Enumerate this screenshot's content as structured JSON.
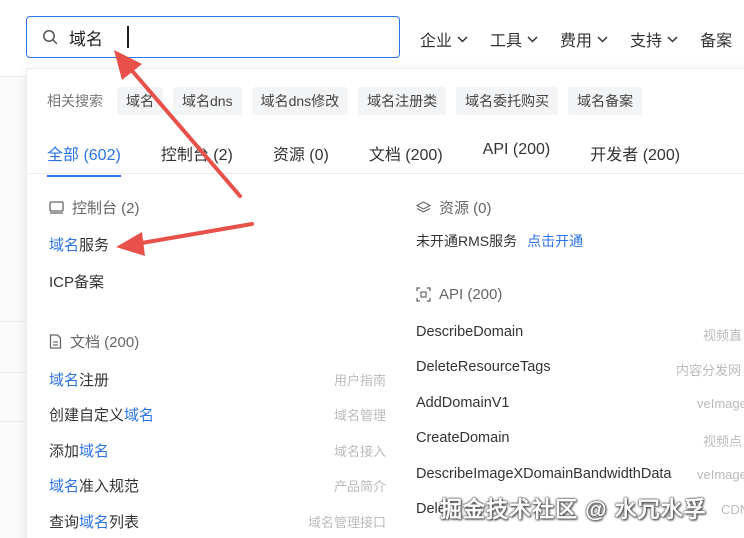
{
  "search": {
    "value": "域名"
  },
  "nav": [
    "企业",
    "工具",
    "费用",
    "支持",
    "备案"
  ],
  "related": {
    "label": "相关搜索",
    "tags": [
      "域名",
      "域名dns",
      "域名dns修改",
      "域名注册类",
      "域名委托购买",
      "域名备案"
    ]
  },
  "tabs": [
    "全部 (602)",
    "控制台 (2)",
    "资源 (0)",
    "文档 (200)",
    "API (200)",
    "开发者 (200)"
  ],
  "console": {
    "title": "控制台 (2)",
    "items": [
      {
        "hl": "域名",
        "rest": "服务"
      },
      {
        "hl": "",
        "rest": "ICP备案"
      }
    ]
  },
  "docs": {
    "title": "文档 (200)",
    "items": [
      {
        "pre": "",
        "hl": "域名",
        "post": "注册",
        "meta": "用户指南"
      },
      {
        "pre": "创建自定义",
        "hl": "域名",
        "post": "",
        "meta": "域名管理"
      },
      {
        "pre": "添加",
        "hl": "域名",
        "post": "",
        "meta": "域名接入"
      },
      {
        "pre": "",
        "hl": "域名",
        "post": "准入规范",
        "meta": "产品简介"
      },
      {
        "pre": "查询",
        "hl": "域名",
        "post": "列表",
        "meta": "域名管理接口"
      }
    ]
  },
  "resources": {
    "title": "资源 (0)",
    "text": "未开通RMS服务",
    "action": "点击开通"
  },
  "api": {
    "title": "API (200)",
    "items": [
      {
        "name": "DescribeDomain",
        "meta": "视频直"
      },
      {
        "name": "DeleteResourceTags",
        "meta": "内容分发网"
      },
      {
        "name": "AddDomainV1",
        "meta": "veImage"
      },
      {
        "name": "CreateDomain",
        "meta": "视频点"
      },
      {
        "name": "DescribeImageXDomainBandwidthData",
        "meta": "veImage"
      },
      {
        "name": "Dele",
        "meta": "CDN"
      }
    ]
  },
  "watermark": "掘金技术社区 @ 水冗水孚",
  "colors": {
    "accent": "#2c74e6",
    "arrow": "#e8504a"
  }
}
